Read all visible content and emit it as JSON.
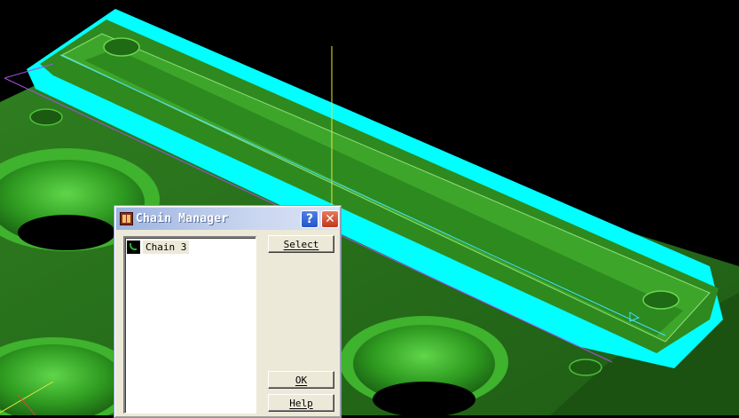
{
  "dialog": {
    "title": "Chain Manager",
    "help_glyph": "?",
    "close_glyph": "✕",
    "chains": [
      {
        "label": "Chain 3",
        "icon": "chain-icon"
      }
    ],
    "buttons": {
      "select": "Select",
      "ok": "OK",
      "help": "Help"
    }
  },
  "scene": {
    "colors": {
      "background": "#000000",
      "part": "#2e7d1e",
      "part_dark": "#1f5a14",
      "highlight": "#00ffff",
      "axis_yellow": "#e6e63c",
      "axis_magenta": "#a050e0"
    }
  }
}
